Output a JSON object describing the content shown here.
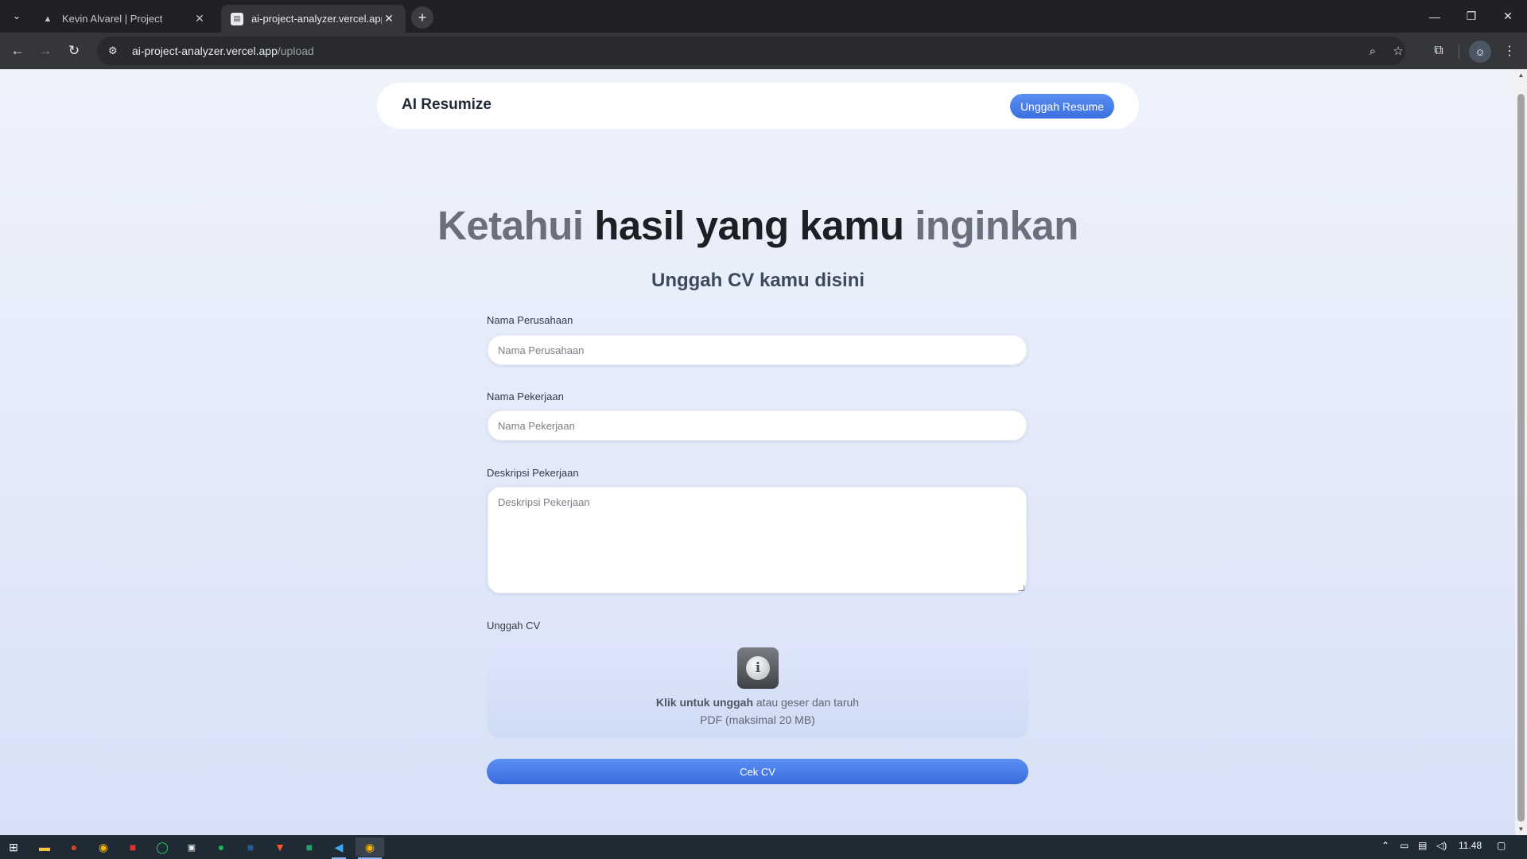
{
  "browser": {
    "tabs": [
      {
        "title": "Kevin Alvarel | Project",
        "favicon": "triangle-logo",
        "active": false
      },
      {
        "title": "ai-project-analyzer.vercel.app/u",
        "favicon": "page-icon",
        "active": true
      }
    ],
    "url_host": "ai-project-analyzer.vercel.app",
    "url_path": "/upload"
  },
  "nav": {
    "brand": "AI Resumize",
    "upload_button": "Unggah Resume"
  },
  "hero": {
    "part1": "Ketahui",
    "part2": " hasil yang kamu ",
    "part3": "inginkan",
    "subtitle": "Unggah CV kamu disini"
  },
  "form": {
    "company_label": "Nama Perusahaan",
    "company_placeholder": "Nama Perusahaan",
    "job_label": "Nama Pekerjaan",
    "job_placeholder": "Nama Pekerjaan",
    "desc_label": "Deskripsi Pekerjaan",
    "desc_placeholder": "Deskripsi Pekerjaan",
    "upload_label": "Unggah CV",
    "upload_click": "Klik untuk unggah",
    "upload_drag": " atau geser dan taruh",
    "upload_hint": "PDF (maksimal 20 MB)",
    "submit": "Cek CV"
  },
  "taskbar": {
    "time": "11.48",
    "apps": [
      "start-icon",
      "file-explorer-icon",
      "powerpoint-icon",
      "chrome-icon",
      "acrobat-icon",
      "whatsapp-icon",
      "app-25-icon",
      "spotify-icon",
      "word-icon",
      "brave-icon",
      "excel-icon",
      "vscode-icon",
      "chrome-active-icon"
    ]
  },
  "colors": {
    "accent": "#3b6fe0",
    "page_bg": "#e3eaf9"
  }
}
